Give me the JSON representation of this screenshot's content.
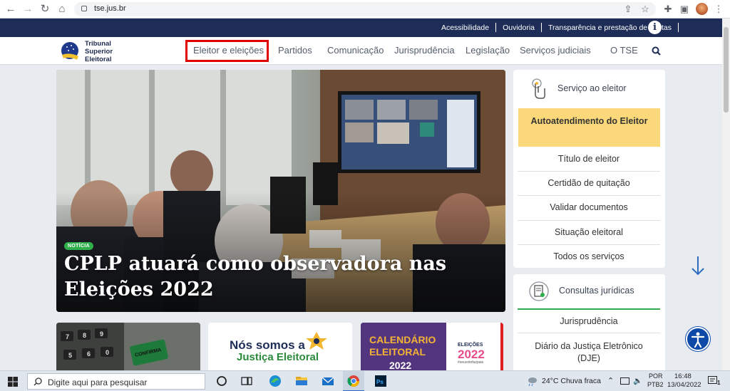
{
  "browser": {
    "url": "tse.jus.br"
  },
  "topbar": {
    "links": [
      "Acessibilidade",
      "Ouvidoria",
      "Transparência e prestação de contas"
    ]
  },
  "header": {
    "logo_lines": [
      "Tribunal",
      "Superior",
      "Eleitoral"
    ],
    "menu": [
      "Eleitor e eleições",
      "Partidos",
      "Comunicação",
      "Jurisprudência",
      "Legislação",
      "Serviços judiciais",
      "O TSE"
    ]
  },
  "hero": {
    "badge": "NOTÍCIA",
    "headline": "CPLP atuará como observadora nas Eleições 2022"
  },
  "services": {
    "title": "Serviço ao eleitor",
    "highlight": "Autoatendimento do Eleitor",
    "items": [
      "Título de eleitor",
      "Certidão de quitação",
      "Validar documentos",
      "Situação eleitoral",
      "Todos os serviços"
    ]
  },
  "legal": {
    "title": "Consultas jurídicas",
    "items": [
      "Jurisprudência",
      "Diário da Justiça Eletrônico (DJE)"
    ]
  },
  "cards": {
    "card2_line1": "Nós somos a",
    "card2_line2": "Justiça Eleitoral",
    "card3_line1": "CALENDÁRIO",
    "card3_line2": "ELEITORAL",
    "card3_year": "2022",
    "card3_logo_top": "ELEIÇÕES",
    "card3_logo_year": "2022",
    "card3_tag": "#seuvotofazpais",
    "card1_keys": [
      "7",
      "8",
      "9",
      "5",
      "6",
      "0"
    ],
    "card1_button": "CONFIRMA"
  },
  "taskbar": {
    "search_placeholder": "Digite aqui para pesquisar",
    "weather": "24°C  Chuva fraca",
    "lang_top": "POR",
    "lang_bottom": "PTB2",
    "time": "16:48",
    "date": "13/04/2022",
    "notif_count": "1"
  },
  "colors": {
    "topbar": "#1e2d57",
    "highlight_yellow": "#fbd87a",
    "menu_outline": "#e00000",
    "badge_green": "#2fb04a"
  }
}
